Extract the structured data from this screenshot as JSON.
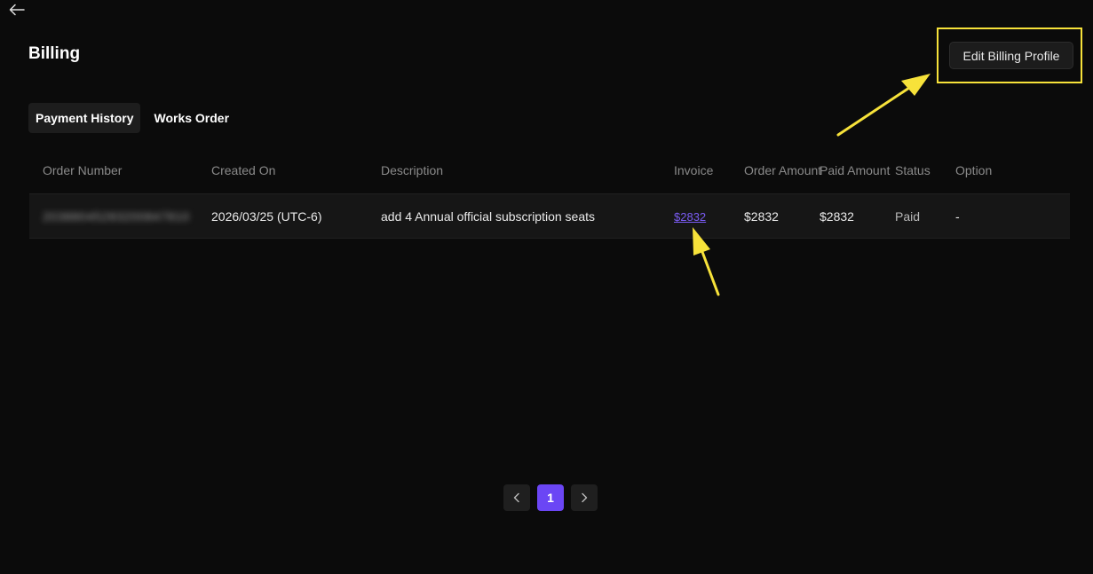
{
  "page": {
    "title": "Billing",
    "edit_billing_profile_label": "Edit Billing Profile"
  },
  "tabs": [
    {
      "label": "Payment History",
      "active": true
    },
    {
      "label": "Works Order",
      "active": false
    }
  ],
  "table": {
    "columns": [
      "Order Number",
      "Created On",
      "Description",
      "Invoice",
      "Order Amount",
      "Paid Amount",
      "Status",
      "Option"
    ],
    "rows": [
      {
        "order_number": "20388045283200847810",
        "created_on": "2026/03/25 (UTC-6)",
        "description": "add 4 Annual official subscription seats",
        "invoice": "$2832",
        "order_amount": "$2832",
        "paid_amount": "$2832",
        "status": "Paid",
        "option": "-"
      }
    ]
  },
  "pagination": {
    "current_page": "1"
  },
  "colors": {
    "background": "#0b0b0b",
    "accent": "#6b46f5",
    "link": "#7b5cf5",
    "annotation": "#f7e23a"
  },
  "icons": {
    "back": "arrow-left-icon",
    "prev": "chevron-left-icon",
    "next": "chevron-right-icon"
  }
}
